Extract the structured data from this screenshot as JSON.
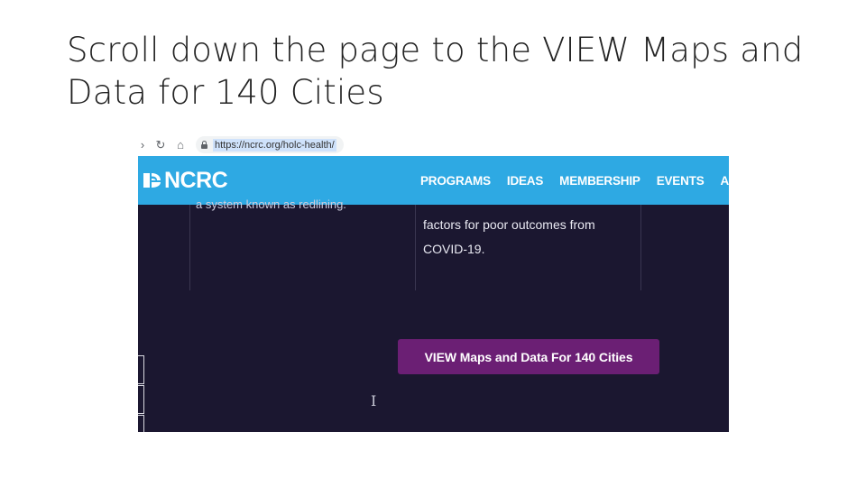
{
  "slide": {
    "title": "Scroll down the page to the VIEW Maps and Data for 140 Cities"
  },
  "browser": {
    "url": "https://ncrc.org/holc-health/",
    "icons": [
      "forward-icon",
      "reload-icon",
      "home-icon",
      "lock-icon"
    ]
  },
  "site": {
    "logo_text": "NCRC",
    "header_color": "#2ea9e3",
    "nav": [
      "PROGRAMS",
      "IDEAS",
      "MEMBERSHIP",
      "EVENTS",
      "ABO"
    ]
  },
  "content": {
    "cut_text": "a system known as redlining.",
    "paragraph": "factors for poor outcomes from COVID-19.",
    "cta_label": "VIEW Maps and Data For 140 Cities",
    "cta_color": "#6b1f74",
    "background": "#1b1730"
  }
}
